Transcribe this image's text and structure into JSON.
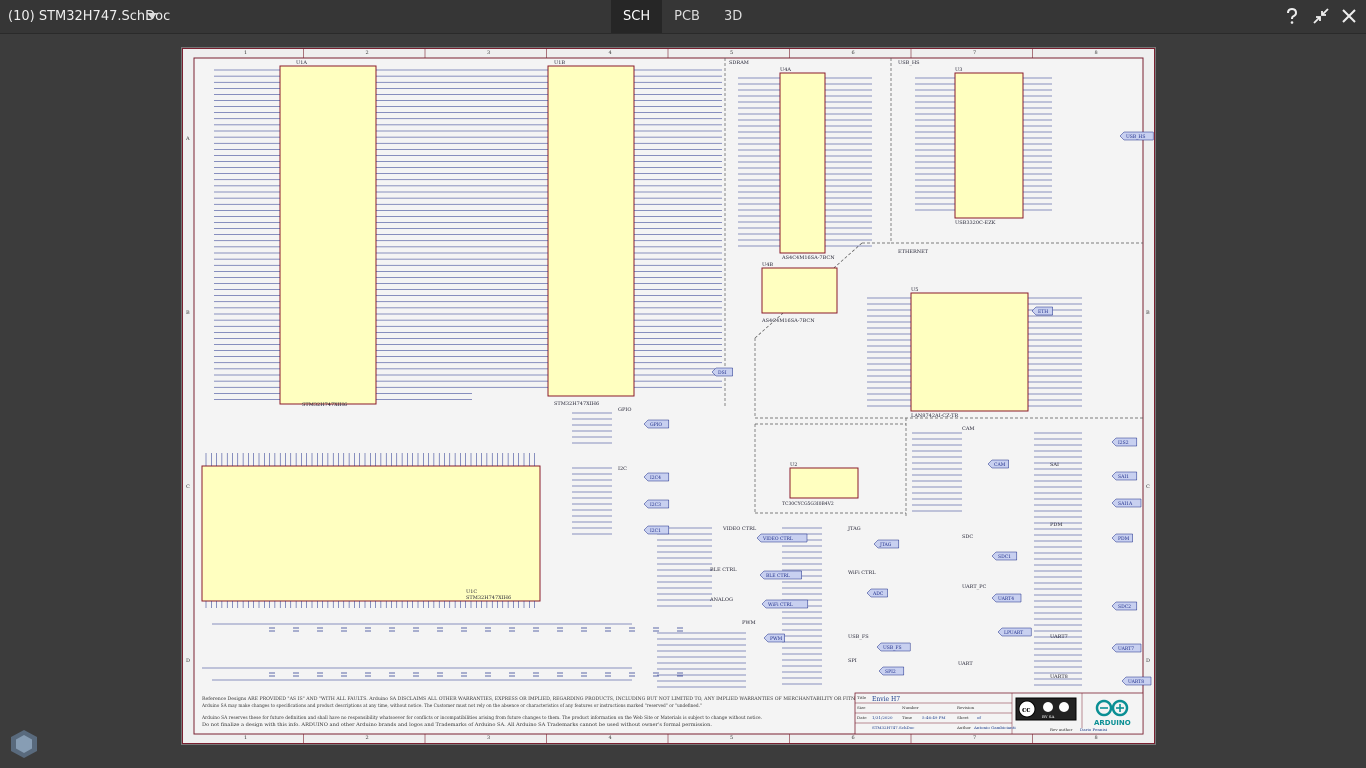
{
  "header": {
    "doc_title": "(10)  STM32H747.SchDoc",
    "tabs": [
      {
        "label": "SCH",
        "active": true
      },
      {
        "label": "PCB",
        "active": false
      },
      {
        "label": "3D",
        "active": false
      }
    ],
    "icons": [
      "help-icon",
      "collapse-icon",
      "close-icon"
    ]
  },
  "schematic": {
    "col_labels": [
      "1",
      "2",
      "3",
      "4",
      "5",
      "6",
      "7",
      "8"
    ],
    "row_labels": [
      "A",
      "B",
      "C",
      "D"
    ],
    "parts": [
      {
        "ref": "U1A",
        "name": "STM32H747XIH6"
      },
      {
        "ref": "U1B",
        "name": "STM32H747XIH6"
      },
      {
        "ref": "U1C",
        "name": "STM32H747XIH6"
      },
      {
        "ref": "U4A",
        "name": "AS4C4M16SA-7BCN"
      },
      {
        "ref": "U4B",
        "name": "AS4C4M16SA-7BCN"
      },
      {
        "ref": "U3",
        "name": "USB3320C-EZK"
      },
      {
        "ref": "U5",
        "name": "LAN8742AI-CZ-TR"
      },
      {
        "ref": "U2",
        "name": "TC30CYCG5G3I0B4V2"
      }
    ],
    "sections": [
      "SDRAM",
      "USB_HS",
      "ETHERNET",
      "CAM",
      "SAI",
      "PDM",
      "SDC",
      "UART_PC",
      "UART7",
      "UART8",
      "VIDEO CTRL",
      "JTAG",
      "BLE CTRL",
      "WiFi CTRL",
      "ANALOG",
      "PWM",
      "USB_FS",
      "SPI",
      "UART",
      "I2C",
      "GPIO"
    ],
    "net_labels": [
      "ADC",
      "VIDEO CTRL",
      "JTAG",
      "BLE CTRL",
      "WiFi CTRL",
      "PWM",
      "USB_FS",
      "SPI2",
      "UART8",
      "CAM",
      "SAI1",
      "SAI1A",
      "PDM",
      "SDC1",
      "SDC2",
      "UART4",
      "LPUART",
      "UART7",
      "I2C4",
      "I2C3",
      "I2C1",
      "GPIO",
      "DSI",
      "ETH",
      "USB_HS",
      "I2S2"
    ],
    "disclaimer": [
      "Reference Designs ARE PROVIDED \"AS IS\" AND \"WITH ALL FAULTS. Arduino SA DISCLAIMS ALL OTHER WARRANTIES, EXPRESS OR IMPLIED, REGARDING PRODUCTS, INCLUDING BUT NOT LIMITED TO, ANY IMPLIED WARRANTIES OF MERCHANTABILITY OR FITNESS FOR A PARTICULAR PURPOSE.",
      "Arduino SA may make changes to specifications and product descriptions at any time, without notice. The Customer must not rely on the absence or characteristics of any features or instructions marked \"reserved\" or \"undefined.\"",
      "Arduino SA reserves these for future definition and shall have no responsibility whatsoever for conflicts or incompatibilities arising from future changes to them. The product information on the Web Site or Materials is subject to change without notice.",
      "Do not finalize a design with this info. ARDUINO and other Arduino brands and logos and Trademarks of Arduino SA. All Arduino SA Trademarks cannot be used without owner's formal permission."
    ],
    "title_block": {
      "brand": "ARDUINO",
      "license": "BY SA",
      "title_label": "Title",
      "title_value": "Envie H7",
      "size_label": "Size",
      "number_label": "Number",
      "revision_label": "Revision",
      "date_label": "Date",
      "date_value": "1/31/2020",
      "time_label": "Time",
      "time_value": "5:46:49 PM",
      "sheet_label": "Sheet",
      "sheet_value": "of",
      "file_value": "STM32H747.SchDoc",
      "author_label": "Author",
      "author_value": "Antonio Gambicianti",
      "revised_label": "Rev author",
      "revised_value": "Dario Pennisi"
    }
  }
}
